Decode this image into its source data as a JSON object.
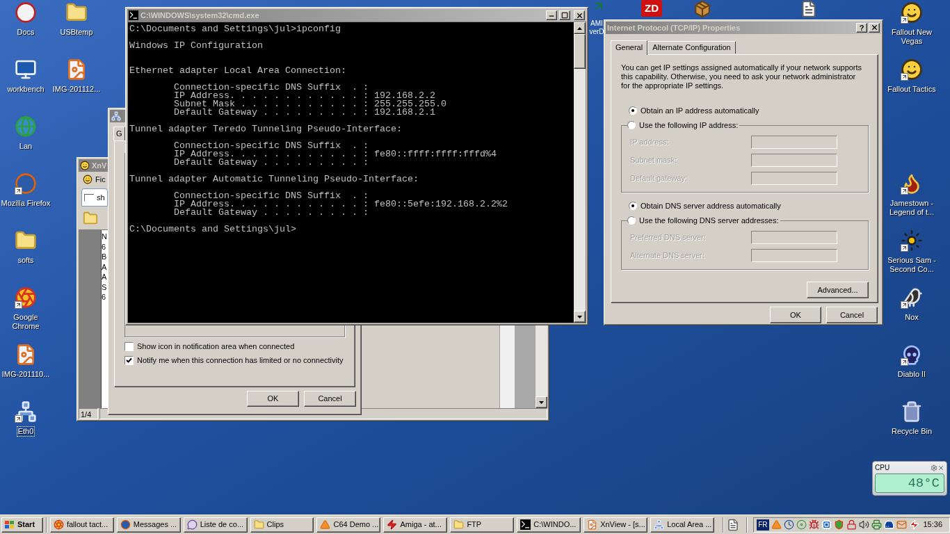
{
  "desktop_icons": [
    {
      "label": "Docs",
      "kind": "ball",
      "shortcut": false,
      "selected": false
    },
    {
      "label": "workbench",
      "kind": "monitor",
      "shortcut": false,
      "selected": false
    },
    {
      "label": "Lan",
      "kind": "globe",
      "shortcut": false,
      "selected": false
    },
    {
      "label": "Mozilla Firefox",
      "kind": "firefox",
      "shortcut": true,
      "selected": false
    },
    {
      "label": "softs",
      "kind": "folder",
      "shortcut": false,
      "selected": false
    },
    {
      "label": "Google Chrome",
      "kind": "chrome",
      "shortcut": true,
      "selected": false
    },
    {
      "label": "IMG-201110...",
      "kind": "image",
      "shortcut": false,
      "selected": false
    },
    {
      "label": "Eth0",
      "kind": "network",
      "shortcut": true,
      "selected": true
    },
    {
      "label": "USBtemp",
      "kind": "folder",
      "shortcut": false,
      "selected": false
    },
    {
      "label": "IMG-201112...",
      "kind": "image",
      "shortcut": false,
      "selected": false
    },
    {
      "label": "Fallout New Vegas",
      "kind": "face",
      "shortcut": true,
      "selected": false
    },
    {
      "label": "Fallout Tactics",
      "kind": "face",
      "shortcut": true,
      "selected": false
    },
    {
      "label": "Jamestown - Legend of t...",
      "kind": "game",
      "shortcut": true,
      "selected": false
    },
    {
      "label": "Serious Sam - Second Co...",
      "kind": "bomb",
      "shortcut": true,
      "selected": false
    },
    {
      "label": "Nox",
      "kind": "wings",
      "shortcut": true,
      "selected": false
    },
    {
      "label": "Diablo II",
      "kind": "skull",
      "shortcut": true,
      "selected": false
    },
    {
      "label": "Recycle Bin",
      "kind": "trash",
      "shortcut": false,
      "selected": false
    }
  ],
  "top_icons": [
    {
      "kind": "app",
      "label": "AMI verD"
    },
    {
      "kind": "zd",
      "badge": "ZD"
    },
    {
      "kind": "box"
    },
    {
      "kind": "document"
    }
  ],
  "xnview_window": {
    "title": "XnV",
    "active": false,
    "menu": "Fic",
    "tab": "sh",
    "list": [
      "N",
      "6",
      "B",
      "A",
      "A",
      "S",
      "6"
    ],
    "status": "1/4"
  },
  "connection_window": {
    "active": false,
    "tab": "G",
    "checkboxes": [
      {
        "label": "Show icon in notification area when connected",
        "checked": false
      },
      {
        "label": "Notify me when this connection has limited or no connectivity",
        "checked": true
      }
    ],
    "buttons": [
      "OK",
      "Cancel"
    ]
  },
  "console_window": {
    "title": "C:\\WINDOWS\\system32\\cmd.exe",
    "active": false,
    "text": "C:\\Documents and Settings\\jul>ipconfig\n\nWindows IP Configuration\n\n\nEthernet adapter Local Area Connection:\n\n        Connection-specific DNS Suffix  . :\n        IP Address. . . . . . . . . . . . : 192.168.2.2\n        Subnet Mask . . . . . . . . . . . : 255.255.255.0\n        Default Gateway . . . . . . . . . : 192.168.2.1\n\nTunnel adapter Teredo Tunneling Pseudo-Interface:\n\n        Connection-specific DNS Suffix  . :\n        IP Address. . . . . . . . . . . . : fe80::ffff:ffff:fffd%4\n        Default Gateway . . . . . . . . . :\n\nTunnel adapter Automatic Tunneling Pseudo-Interface:\n\n        Connection-specific DNS Suffix  . :\n        IP Address. . . . . . . . . . . . : fe80::5efe:192.168.2.2%2\n        Default Gateway . . . . . . . . . :\n\nC:\\Documents and Settings\\jul>"
  },
  "tcpip_dialog": {
    "title": "Internet Protocol (TCP/IP) Properties",
    "active": false,
    "help": "?",
    "tabs": [
      {
        "label": "General",
        "selected": true
      },
      {
        "label": "Alternate Configuration",
        "selected": false
      }
    ],
    "intro": "You can get IP settings assigned automatically if your network supports this capability. Otherwise, you need to ask your network administrator for the appropriate IP settings.",
    "ip_auto": {
      "label": "Obtain an IP address automatically",
      "selected": true
    },
    "ip_manual": {
      "label": "Use the following IP address:",
      "selected": false,
      "fields": [
        {
          "label": "IP address:",
          "disabled": true
        },
        {
          "label": "Subnet mask:",
          "disabled": true
        },
        {
          "label": "Default gateway:",
          "disabled": true
        }
      ]
    },
    "dns_auto": {
      "label": "Obtain DNS server address automatically",
      "selected": true
    },
    "dns_manual": {
      "label": "Use the following DNS server addresses:",
      "selected": false,
      "fields": [
        {
          "label": "Preferred DNS server:",
          "disabled": true
        },
        {
          "label": "Alternate DNS server:",
          "disabled": true
        }
      ]
    },
    "advanced_button": "Advanced...",
    "buttons": [
      "OK",
      "Cancel"
    ]
  },
  "cpu_gadget": {
    "title": "CPU",
    "reading": "48°C"
  },
  "taskbar": {
    "start": "Start",
    "buttons": [
      {
        "label": "fallout tact...",
        "kind": "chrome"
      },
      {
        "label": "Messages ...",
        "kind": "firefox"
      },
      {
        "label": "Liste de co...",
        "kind": "chat"
      },
      {
        "label": "Clips",
        "kind": "folder"
      },
      {
        "label": "C64 Demo ...",
        "kind": "cone"
      },
      {
        "label": "Amiga - at...",
        "kind": "zap"
      },
      {
        "label": "FTP",
        "kind": "folder"
      },
      {
        "label": "C:\\WINDO...",
        "kind": "terminal"
      },
      {
        "label": "XnView - [s...",
        "kind": "image"
      },
      {
        "label": "Local Area ...",
        "kind": "network"
      }
    ],
    "language": "FR",
    "clock": "15:36"
  }
}
